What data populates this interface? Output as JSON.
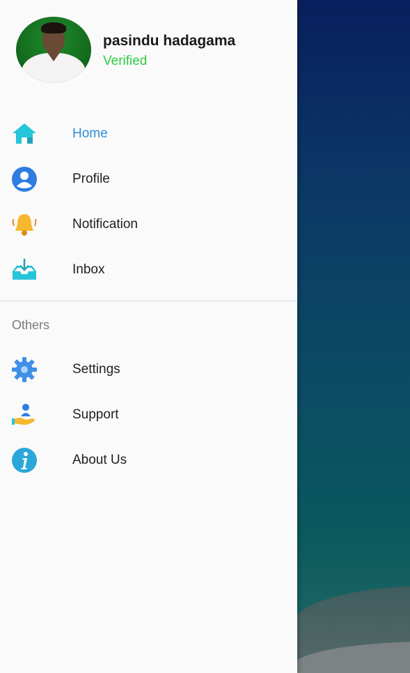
{
  "user": {
    "name": "pasindu hadagama",
    "status": "Verified"
  },
  "menu": {
    "primary": [
      {
        "label": "Home",
        "icon": "home-icon",
        "active": true
      },
      {
        "label": "Profile",
        "icon": "profile-icon",
        "active": false
      },
      {
        "label": "Notification",
        "icon": "bell-icon",
        "active": false
      },
      {
        "label": "Inbox",
        "icon": "inbox-icon",
        "active": false
      }
    ],
    "section_label": "Others",
    "secondary": [
      {
        "label": "Settings",
        "icon": "gear-icon"
      },
      {
        "label": "Support",
        "icon": "support-icon"
      },
      {
        "label": "About Us",
        "icon": "info-icon"
      }
    ]
  },
  "colors": {
    "active": "#2f8fd8",
    "verified": "#2ecc40",
    "drawer_bg": "#fafafa"
  }
}
